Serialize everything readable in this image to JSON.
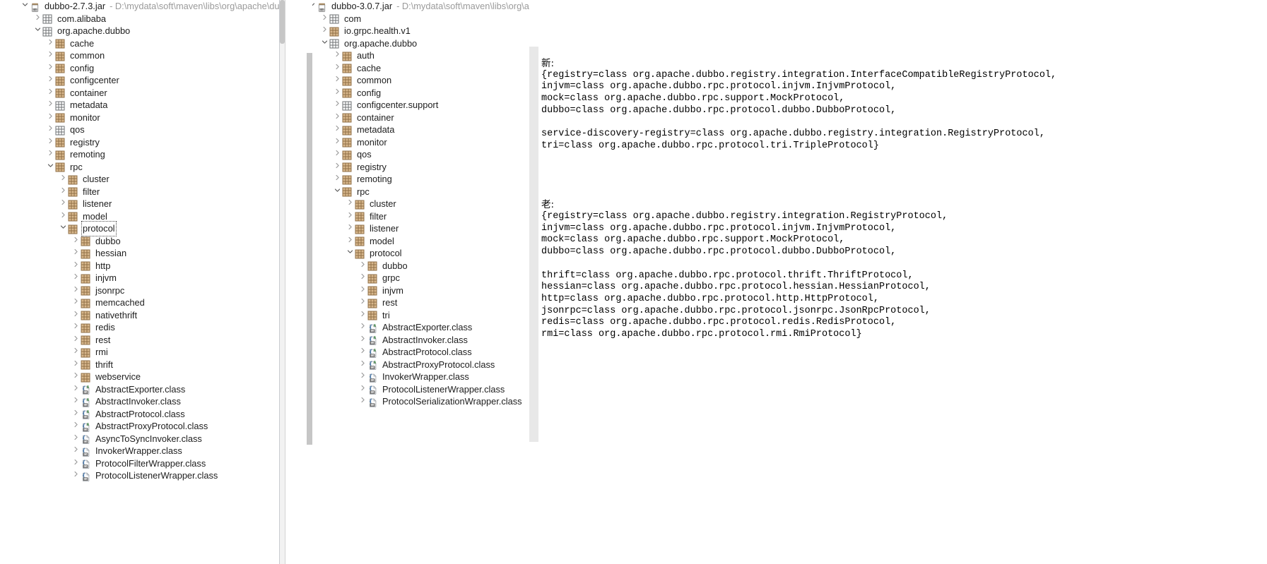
{
  "left_tree": {
    "scrollbar": {
      "name": "vertical-scrollbar"
    },
    "rows": [
      {
        "indent": 0,
        "arrow": "down",
        "icon": "jar-icon",
        "label": "dubbo-2.7.3.jar",
        "path": "- D:\\mydata\\soft\\maven\\libs\\org\\apache\\dubbo\\d",
        "focused": false
      },
      {
        "indent": 1,
        "arrow": "right",
        "icon": "package-empty-icon",
        "label": "com.alibaba",
        "path": "",
        "focused": false
      },
      {
        "indent": 1,
        "arrow": "down",
        "icon": "package-empty-icon",
        "label": "org.apache.dubbo",
        "path": "",
        "focused": false
      },
      {
        "indent": 2,
        "arrow": "right",
        "icon": "package-icon",
        "label": "cache",
        "path": "",
        "focused": false
      },
      {
        "indent": 2,
        "arrow": "right",
        "icon": "package-icon",
        "label": "common",
        "path": "",
        "focused": false
      },
      {
        "indent": 2,
        "arrow": "right",
        "icon": "package-icon",
        "label": "config",
        "path": "",
        "focused": false
      },
      {
        "indent": 2,
        "arrow": "right",
        "icon": "package-icon",
        "label": "configcenter",
        "path": "",
        "focused": false
      },
      {
        "indent": 2,
        "arrow": "right",
        "icon": "package-icon",
        "label": "container",
        "path": "",
        "focused": false
      },
      {
        "indent": 2,
        "arrow": "right",
        "icon": "package-empty-icon",
        "label": "metadata",
        "path": "",
        "focused": false
      },
      {
        "indent": 2,
        "arrow": "right",
        "icon": "package-icon",
        "label": "monitor",
        "path": "",
        "focused": false
      },
      {
        "indent": 2,
        "arrow": "right",
        "icon": "package-empty-icon",
        "label": "qos",
        "path": "",
        "focused": false
      },
      {
        "indent": 2,
        "arrow": "right",
        "icon": "package-icon",
        "label": "registry",
        "path": "",
        "focused": false
      },
      {
        "indent": 2,
        "arrow": "right",
        "icon": "package-icon",
        "label": "remoting",
        "path": "",
        "focused": false
      },
      {
        "indent": 2,
        "arrow": "down",
        "icon": "package-icon",
        "label": "rpc",
        "path": "",
        "focused": false
      },
      {
        "indent": 3,
        "arrow": "right",
        "icon": "package-icon",
        "label": "cluster",
        "path": "",
        "focused": false
      },
      {
        "indent": 3,
        "arrow": "right",
        "icon": "package-icon",
        "label": "filter",
        "path": "",
        "focused": false
      },
      {
        "indent": 3,
        "arrow": "right",
        "icon": "package-icon",
        "label": "listener",
        "path": "",
        "focused": false
      },
      {
        "indent": 3,
        "arrow": "right",
        "icon": "package-icon",
        "label": "model",
        "path": "",
        "focused": false
      },
      {
        "indent": 3,
        "arrow": "down",
        "icon": "package-icon",
        "label": "protocol",
        "path": "",
        "focused": true
      },
      {
        "indent": 4,
        "arrow": "right",
        "icon": "package-icon",
        "label": "dubbo",
        "path": "",
        "focused": false
      },
      {
        "indent": 4,
        "arrow": "right",
        "icon": "package-icon",
        "label": "hessian",
        "path": "",
        "focused": false
      },
      {
        "indent": 4,
        "arrow": "right",
        "icon": "package-icon",
        "label": "http",
        "path": "",
        "focused": false
      },
      {
        "indent": 4,
        "arrow": "right",
        "icon": "package-icon",
        "label": "injvm",
        "path": "",
        "focused": false
      },
      {
        "indent": 4,
        "arrow": "right",
        "icon": "package-icon",
        "label": "jsonrpc",
        "path": "",
        "focused": false
      },
      {
        "indent": 4,
        "arrow": "right",
        "icon": "package-icon",
        "label": "memcached",
        "path": "",
        "focused": false
      },
      {
        "indent": 4,
        "arrow": "right",
        "icon": "package-icon",
        "label": "nativethrift",
        "path": "",
        "focused": false
      },
      {
        "indent": 4,
        "arrow": "right",
        "icon": "package-icon",
        "label": "redis",
        "path": "",
        "focused": false
      },
      {
        "indent": 4,
        "arrow": "right",
        "icon": "package-icon",
        "label": "rest",
        "path": "",
        "focused": false
      },
      {
        "indent": 4,
        "arrow": "right",
        "icon": "package-icon",
        "label": "rmi",
        "path": "",
        "focused": false
      },
      {
        "indent": 4,
        "arrow": "right",
        "icon": "package-icon",
        "label": "thrift",
        "path": "",
        "focused": false
      },
      {
        "indent": 4,
        "arrow": "right",
        "icon": "package-icon",
        "label": "webservice",
        "path": "",
        "focused": false
      },
      {
        "indent": 4,
        "arrow": "right",
        "icon": "abstract-class-icon",
        "label": "AbstractExporter.class",
        "path": "",
        "focused": false
      },
      {
        "indent": 4,
        "arrow": "right",
        "icon": "abstract-class-icon",
        "label": "AbstractInvoker.class",
        "path": "",
        "focused": false
      },
      {
        "indent": 4,
        "arrow": "right",
        "icon": "abstract-class-icon",
        "label": "AbstractProtocol.class",
        "path": "",
        "focused": false
      },
      {
        "indent": 4,
        "arrow": "right",
        "icon": "abstract-class-icon",
        "label": "AbstractProxyProtocol.class",
        "path": "",
        "focused": false
      },
      {
        "indent": 4,
        "arrow": "right",
        "icon": "class-icon",
        "label": "AsyncToSyncInvoker.class",
        "path": "",
        "focused": false
      },
      {
        "indent": 4,
        "arrow": "right",
        "icon": "class-icon",
        "label": "InvokerWrapper.class",
        "path": "",
        "focused": false
      },
      {
        "indent": 4,
        "arrow": "right",
        "icon": "class-icon",
        "label": "ProtocolFilterWrapper.class",
        "path": "",
        "focused": false
      },
      {
        "indent": 4,
        "arrow": "right",
        "icon": "class-icon",
        "label": "ProtocolListenerWrapper.class",
        "path": "",
        "focused": false
      }
    ]
  },
  "right_tree": {
    "scrollbar": {
      "name": "vertical-scrollbar"
    },
    "rows": [
      {
        "indent": 0,
        "arrow": "down",
        "icon": "jar-icon",
        "label": "dubbo-3.0.7.jar",
        "path": "- D:\\mydata\\soft\\maven\\libs\\org\\apache\\dubb",
        "focused": false
      },
      {
        "indent": 1,
        "arrow": "right",
        "icon": "package-empty-icon",
        "label": "com",
        "path": "",
        "focused": false
      },
      {
        "indent": 1,
        "arrow": "right",
        "icon": "package-icon",
        "label": "io.grpc.health.v1",
        "path": "",
        "focused": false
      },
      {
        "indent": 1,
        "arrow": "down",
        "icon": "package-empty-icon",
        "label": "org.apache.dubbo",
        "path": "",
        "focused": false
      },
      {
        "indent": 2,
        "arrow": "right",
        "icon": "package-icon",
        "label": "auth",
        "path": "",
        "focused": false
      },
      {
        "indent": 2,
        "arrow": "right",
        "icon": "package-icon",
        "label": "cache",
        "path": "",
        "focused": false
      },
      {
        "indent": 2,
        "arrow": "right",
        "icon": "package-icon",
        "label": "common",
        "path": "",
        "focused": false
      },
      {
        "indent": 2,
        "arrow": "right",
        "icon": "package-icon",
        "label": "config",
        "path": "",
        "focused": false
      },
      {
        "indent": 2,
        "arrow": "right",
        "icon": "package-empty-icon",
        "label": "configcenter.support",
        "path": "",
        "focused": false
      },
      {
        "indent": 2,
        "arrow": "right",
        "icon": "package-icon",
        "label": "container",
        "path": "",
        "focused": false
      },
      {
        "indent": 2,
        "arrow": "right",
        "icon": "package-icon",
        "label": "metadata",
        "path": "",
        "focused": false
      },
      {
        "indent": 2,
        "arrow": "right",
        "icon": "package-icon",
        "label": "monitor",
        "path": "",
        "focused": false
      },
      {
        "indent": 2,
        "arrow": "right",
        "icon": "package-icon",
        "label": "qos",
        "path": "",
        "focused": false
      },
      {
        "indent": 2,
        "arrow": "right",
        "icon": "package-icon",
        "label": "registry",
        "path": "",
        "focused": false
      },
      {
        "indent": 2,
        "arrow": "right",
        "icon": "package-icon",
        "label": "remoting",
        "path": "",
        "focused": false
      },
      {
        "indent": 2,
        "arrow": "down",
        "icon": "package-icon",
        "label": "rpc",
        "path": "",
        "focused": false
      },
      {
        "indent": 3,
        "arrow": "right",
        "icon": "package-icon",
        "label": "cluster",
        "path": "",
        "focused": false
      },
      {
        "indent": 3,
        "arrow": "right",
        "icon": "package-icon",
        "label": "filter",
        "path": "",
        "focused": false
      },
      {
        "indent": 3,
        "arrow": "right",
        "icon": "package-icon",
        "label": "listener",
        "path": "",
        "focused": false
      },
      {
        "indent": 3,
        "arrow": "right",
        "icon": "package-icon",
        "label": "model",
        "path": "",
        "focused": false
      },
      {
        "indent": 3,
        "arrow": "down",
        "icon": "package-icon",
        "label": "protocol",
        "path": "",
        "focused": false
      },
      {
        "indent": 4,
        "arrow": "right",
        "icon": "package-icon",
        "label": "dubbo",
        "path": "",
        "focused": false
      },
      {
        "indent": 4,
        "arrow": "right",
        "icon": "package-icon",
        "label": "grpc",
        "path": "",
        "focused": false
      },
      {
        "indent": 4,
        "arrow": "right",
        "icon": "package-icon",
        "label": "injvm",
        "path": "",
        "focused": false
      },
      {
        "indent": 4,
        "arrow": "right",
        "icon": "package-icon",
        "label": "rest",
        "path": "",
        "focused": false
      },
      {
        "indent": 4,
        "arrow": "right",
        "icon": "package-icon",
        "label": "tri",
        "path": "",
        "focused": false
      },
      {
        "indent": 4,
        "arrow": "right",
        "icon": "abstract-class-icon",
        "label": "AbstractExporter.class",
        "path": "",
        "focused": false
      },
      {
        "indent": 4,
        "arrow": "right",
        "icon": "abstract-class-icon",
        "label": "AbstractInvoker.class",
        "path": "",
        "focused": false
      },
      {
        "indent": 4,
        "arrow": "right",
        "icon": "abstract-class-icon",
        "label": "AbstractProtocol.class",
        "path": "",
        "focused": false
      },
      {
        "indent": 4,
        "arrow": "right",
        "icon": "abstract-class-icon",
        "label": "AbstractProxyProtocol.class",
        "path": "",
        "focused": false
      },
      {
        "indent": 4,
        "arrow": "right",
        "icon": "class-icon",
        "label": "InvokerWrapper.class",
        "path": "",
        "focused": false
      },
      {
        "indent": 4,
        "arrow": "right",
        "icon": "class-icon",
        "label": "ProtocolListenerWrapper.class",
        "path": "",
        "focused": false
      },
      {
        "indent": 4,
        "arrow": "right",
        "icon": "class-icon",
        "label": "ProtocolSerializationWrapper.class",
        "path": "",
        "focused": false
      }
    ]
  },
  "text_pane": {
    "new_heading": "新:",
    "new_block": [
      "{registry=class org.apache.dubbo.registry.integration.InterfaceCompatibleRegistryProtocol,",
      "injvm=class org.apache.dubbo.rpc.protocol.injvm.InjvmProtocol,",
      "mock=class org.apache.dubbo.rpc.support.MockProtocol,",
      "dubbo=class org.apache.dubbo.rpc.protocol.dubbo.DubboProtocol,",
      "",
      "service-discovery-registry=class org.apache.dubbo.registry.integration.RegistryProtocol,",
      "tri=class org.apache.dubbo.rpc.protocol.tri.TripleProtocol}"
    ],
    "old_heading": "老:",
    "old_block": [
      "{registry=class org.apache.dubbo.registry.integration.RegistryProtocol,",
      "injvm=class org.apache.dubbo.rpc.protocol.injvm.InjvmProtocol,",
      "mock=class org.apache.dubbo.rpc.support.MockProtocol,",
      "dubbo=class org.apache.dubbo.rpc.protocol.dubbo.DubboProtocol,",
      "",
      "thrift=class org.apache.dubbo.rpc.protocol.thrift.ThriftProtocol,",
      "hessian=class org.apache.dubbo.rpc.protocol.hessian.HessianProtocol,",
      "http=class org.apache.dubbo.rpc.protocol.http.HttpProtocol,",
      "jsonrpc=class org.apache.dubbo.rpc.protocol.jsonrpc.JsonRpcProtocol,",
      "redis=class org.apache.dubbo.rpc.protocol.redis.RedisProtocol,",
      "rmi=class org.apache.dubbo.rpc.protocol.rmi.RmiProtocol}"
    ]
  },
  "colors": {
    "package_fill": "#c9a477",
    "package_empty_stroke": "#6e7073",
    "class_blue": "#3b6ea5",
    "abstract_green": "#2e7d32",
    "jar_brown": "#9a7b4f",
    "scrollbar": "#c6c6c6",
    "gutter": "#e8e8e8",
    "path_text": "#9a9a9a"
  }
}
